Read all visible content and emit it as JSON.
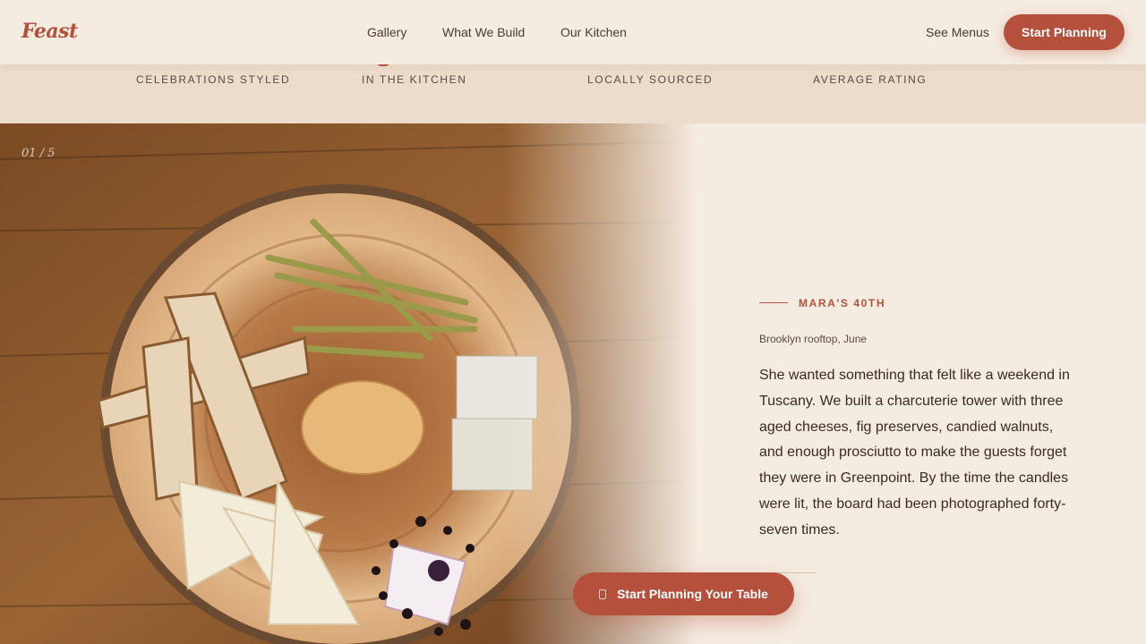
{
  "header": {
    "logo": "Feast",
    "nav": [
      "Gallery",
      "What We Build",
      "Our Kitchen"
    ],
    "see_menus": "See Menus",
    "cta": "Start Planning"
  },
  "stats": {
    "labels": [
      "CELEBRATIONS STYLED",
      "IN THE KITCHEN",
      "LOCALLY SOURCED",
      "AVERAGE RATING"
    ]
  },
  "gallery": {
    "counter": "01 / 5",
    "image": "charcuterie-board-photo"
  },
  "story": {
    "eyebrow": "MARA'S 40TH",
    "location": "Brooklyn rooftop, June",
    "body": "She wanted something that felt like a weekend in Tuscany. We built a charcuterie tower with three aged cheeses, fig preserves, candied walnuts, and enough prosciutto to make the guests forget they were in Greenpoint. By the time the candles were lit, the board had been photographed forty-seven times."
  },
  "floating_cta": {
    "label": "Start Planning Your Table",
    "icon": "calendar-icon"
  },
  "colors": {
    "accent": "#b4503c",
    "background": "#f5ece1",
    "band": "#ecdccb",
    "text": "#3a2a22"
  }
}
